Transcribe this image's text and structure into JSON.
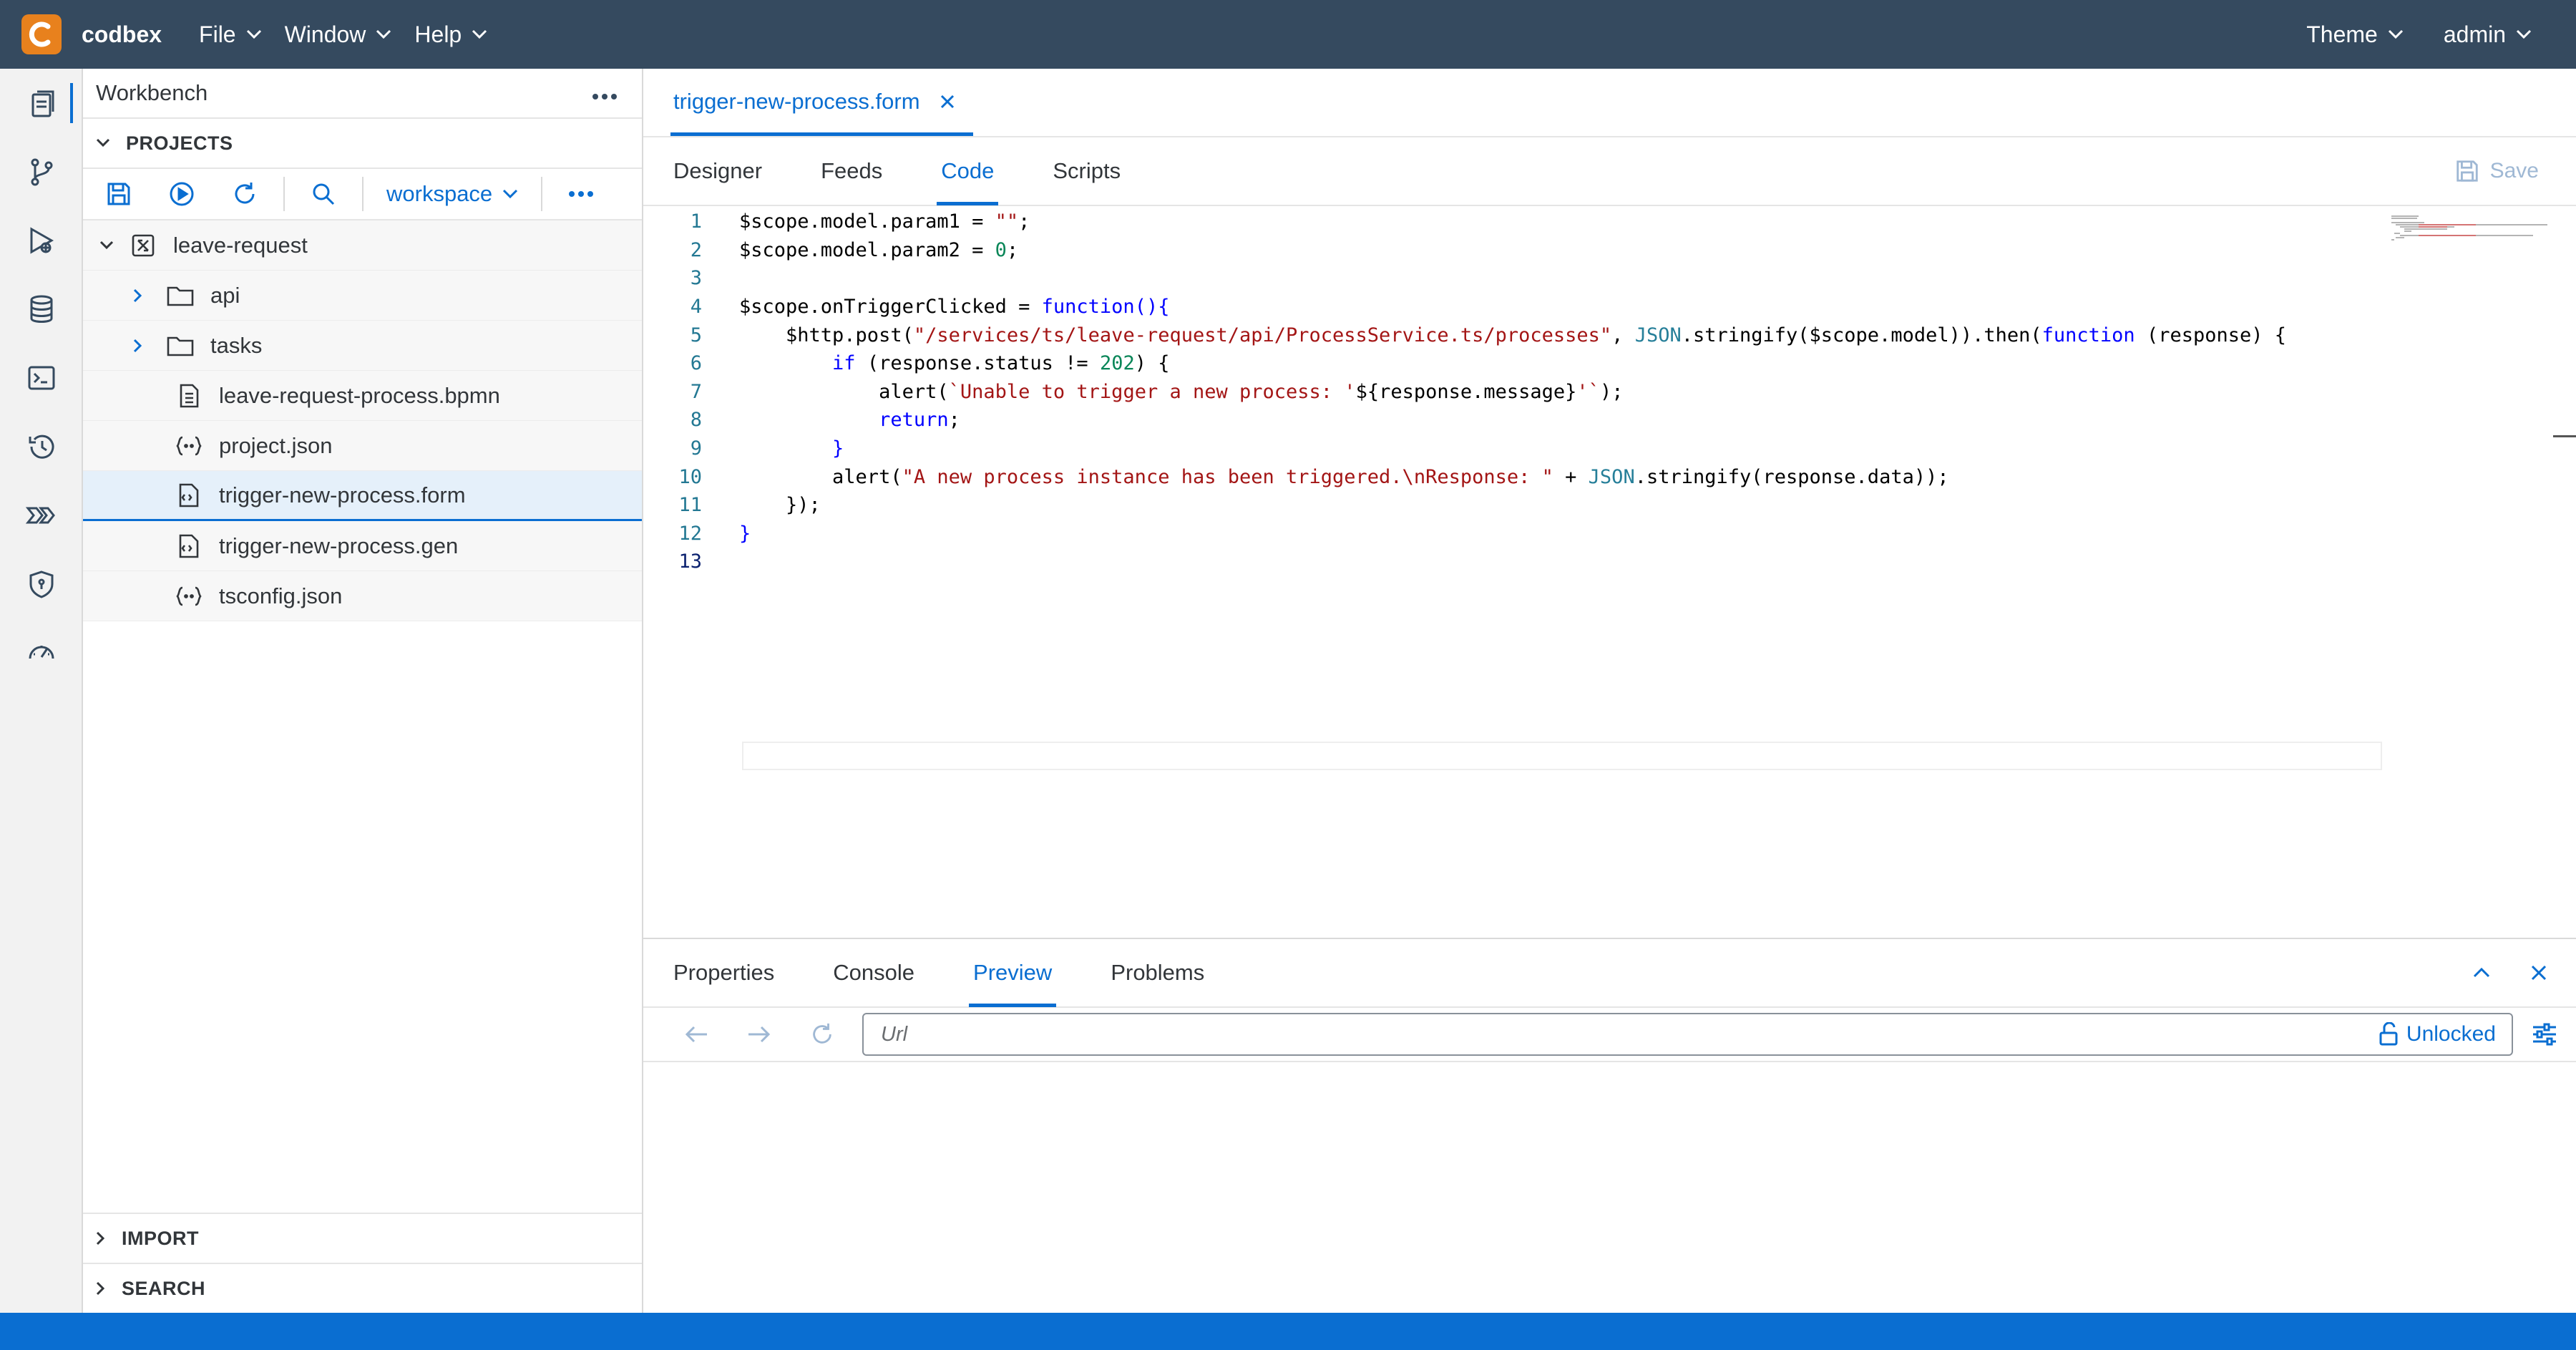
{
  "app": {
    "brand": "codbex",
    "menus": [
      {
        "label": "File"
      },
      {
        "label": "Window"
      },
      {
        "label": "Help"
      }
    ],
    "theme_label": "Theme",
    "user_label": "admin"
  },
  "activity_bar": {
    "items": [
      {
        "icon": "files-icon",
        "active": true
      },
      {
        "icon": "git-branch-icon"
      },
      {
        "icon": "debug-icon"
      },
      {
        "icon": "database-icon"
      },
      {
        "icon": "terminal-icon"
      },
      {
        "icon": "history-icon"
      },
      {
        "icon": "pipeline-icon"
      },
      {
        "icon": "security-icon"
      },
      {
        "icon": "performance-icon"
      }
    ]
  },
  "explorer": {
    "title": "Workbench",
    "projects_label": "PROJECTS",
    "workspace_label": "workspace",
    "tree": [
      {
        "label": "leave-request",
        "type": "project",
        "level": 0,
        "expanded": true
      },
      {
        "label": "api",
        "type": "folder",
        "level": 1
      },
      {
        "label": "tasks",
        "type": "folder",
        "level": 1
      },
      {
        "label": "leave-request-process.bpmn",
        "type": "file",
        "level": 1
      },
      {
        "label": "project.json",
        "type": "json",
        "level": 1
      },
      {
        "label": "trigger-new-process.form",
        "type": "form",
        "level": 1,
        "selected": true
      },
      {
        "label": "trigger-new-process.gen",
        "type": "form",
        "level": 1
      },
      {
        "label": "tsconfig.json",
        "type": "json",
        "level": 1
      }
    ],
    "import_label": "IMPORT",
    "search_label": "SEARCH"
  },
  "editor": {
    "tab_label": "trigger-new-process.form",
    "subtabs": [
      "Designer",
      "Feeds",
      "Code",
      "Scripts"
    ],
    "active_subtab": "Code",
    "save_label": "Save",
    "line_numbers": [
      "1",
      "2",
      "3",
      "4",
      "5",
      "6",
      "7",
      "8",
      "9",
      "10",
      "11",
      "12",
      "13"
    ],
    "code": {
      "l1a": "$scope.model.param1 = ",
      "l1s": "\"\"",
      "l1b": ";",
      "l2a": "$scope.model.param2 = ",
      "l2n": "0",
      "l2b": ";",
      "l4a": "$scope.onTriggerClicked = ",
      "l4k": "function",
      "l4b": "(){",
      "l5a": "    $http.post(",
      "l5s": "\"/services/ts/leave-request/api/ProcessService.ts/processes\"",
      "l5b": ", ",
      "l5t": "JSON",
      "l5c": ".stringify($scope.model)).then(",
      "l5k": "function",
      "l5d": " (response) {",
      "l6k": "        if",
      "l6a": " (response.status != ",
      "l6n": "202",
      "l6b": ") {",
      "l7a": "            alert(",
      "l7s": "`Unable to trigger a new process: '",
      "l7b": "${response.message}",
      "l7s2": "'`",
      "l7c": ");",
      "l8k": "            return",
      "l8a": ";",
      "l9a": "        }",
      "l10a": "        alert(",
      "l10s": "\"A new process instance has been triggered.\\nResponse: \"",
      "l10b": " + ",
      "l10t": "JSON",
      "l10c": ".stringify(response.data));",
      "l11a": "    });",
      "l12a": "}"
    }
  },
  "panel": {
    "tabs": [
      "Properties",
      "Console",
      "Preview",
      "Problems"
    ],
    "active_tab": "Preview",
    "url_placeholder": "Url",
    "lock_label": "Unlocked"
  },
  "colors": {
    "shellbar": "#354a5f",
    "accent": "#0a6ed1",
    "brand_orange": "#e8811d",
    "statusbar": "#0a6ed1"
  }
}
